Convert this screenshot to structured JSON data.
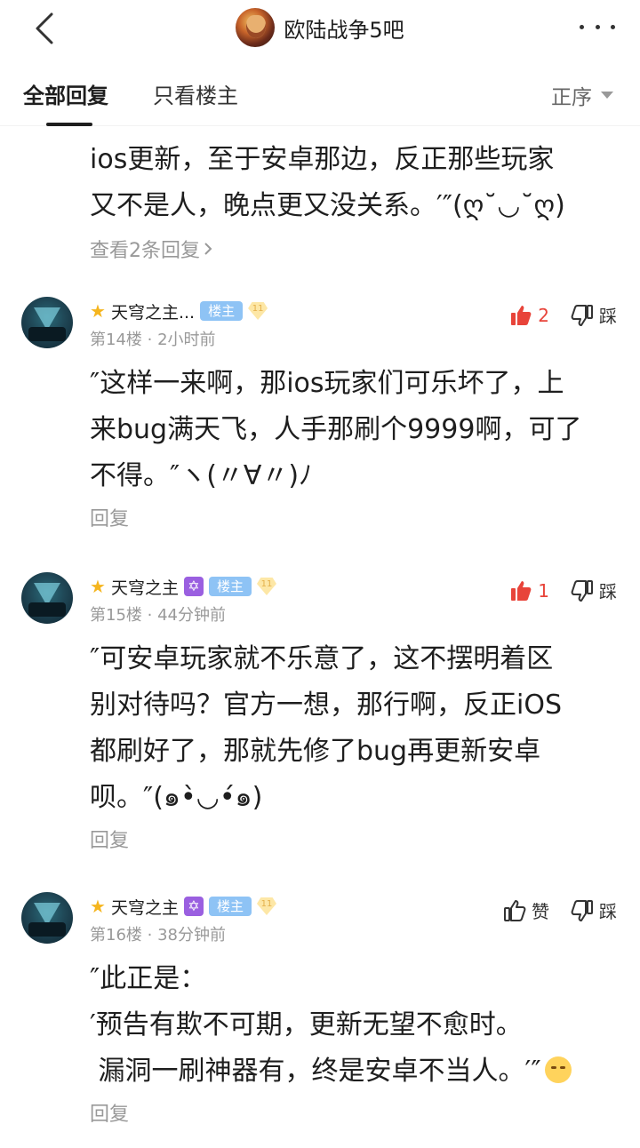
{
  "header": {
    "forum_name": "欧陆战争5吧"
  },
  "tabs": {
    "all": "全部回复",
    "owner_only": "只看楼主",
    "sort": "正序"
  },
  "partial_post": {
    "text": "ios更新，至于安卓那边，反正那些玩家\n又不是人，晚点更又没关系。′″(ღ˘◡˘ღ)",
    "sub_replies": "查看2条回复"
  },
  "posts": [
    {
      "username": "天穹之主...",
      "owner_badge": "楼主",
      "level": "11",
      "floor_time": "第14楼 · 2小时前",
      "like_count": "2",
      "dislike_label": "踩",
      "text": "″这样一来啊，那ios玩家们可乐坏了，上\n来bug满天飞，人手那刷个9999啊，可了\n不得。″ヽ(〃∀〃)ﾉ",
      "reply": "回复"
    },
    {
      "username": "天穹之主",
      "owner_badge": "楼主",
      "level": "11",
      "floor_time": "第15楼 · 44分钟前",
      "like_count": "1",
      "dislike_label": "踩",
      "text": "″可安卓玩家就不乐意了，这不摆明着区\n别对待吗？官方一想，那行啊，反正iOS\n都刷好了，那就先修了bug再更新安卓\n呗。″(๑•̀◡•́๑)",
      "reply": "回复"
    },
    {
      "username": "天穹之主",
      "owner_badge": "楼主",
      "level": "11",
      "floor_time": "第16楼 · 38分钟前",
      "like_label": "赞",
      "dislike_label": "踩",
      "text": "″此正是：\n′预告有欺不可期，更新无望不愈时。\n 漏洞一刷神器有，终是安卓不当人。′″",
      "reply": "回复"
    }
  ],
  "colors": {
    "like_active": "#e8443a",
    "owner_badge": "#8ec3f5",
    "muted_text": "#999999"
  }
}
